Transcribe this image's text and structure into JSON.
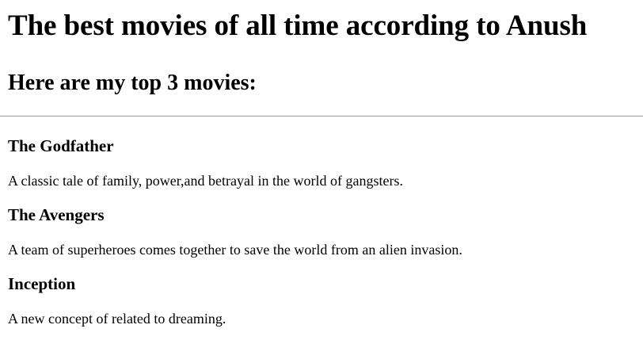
{
  "page": {
    "heading": "The best movies of all time according to Anush",
    "subheading": "Here are my top 3 movies:"
  },
  "movies": [
    {
      "title": "The Godfather",
      "description": "A classic tale of family, power,and betrayal in the world of gangsters."
    },
    {
      "title": "The Avengers",
      "description": "A team of superheroes comes together to save the world from an alien invasion."
    },
    {
      "title": "Inception",
      "description": "A new concept of related to dreaming."
    }
  ]
}
